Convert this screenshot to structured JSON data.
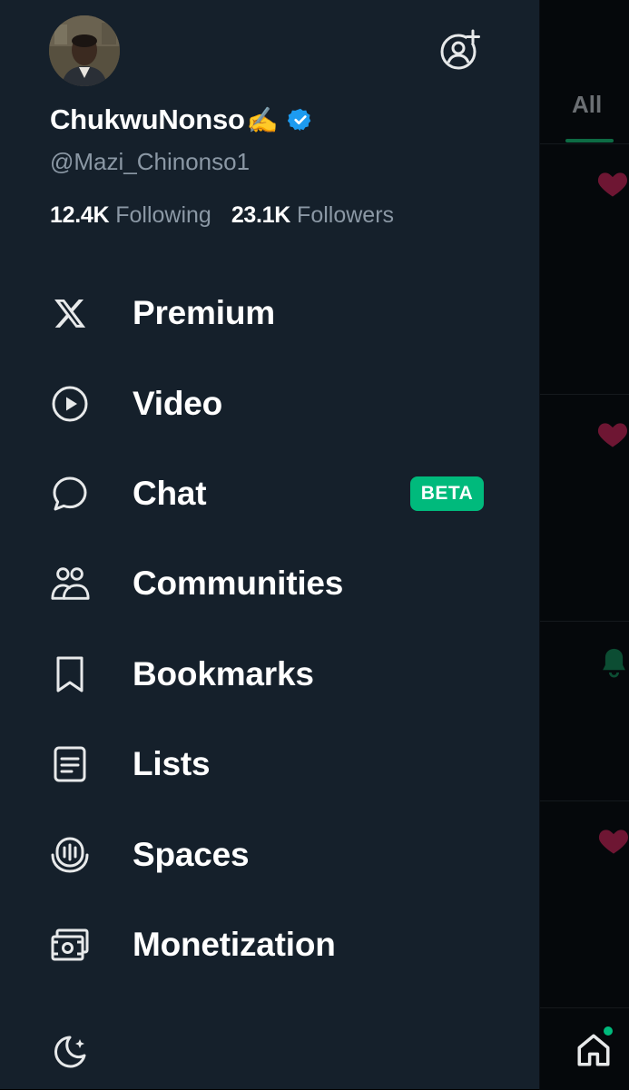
{
  "profile": {
    "display_name": "ChukwuNonso",
    "name_emoji": "✍️",
    "handle": "@Mazi_Chinonso1",
    "following_count": "12.4K",
    "following_label": "Following",
    "followers_count": "23.1K",
    "followers_label": "Followers"
  },
  "menu": {
    "items": [
      {
        "label": "Premium",
        "icon": "x-logo-icon"
      },
      {
        "label": "Video",
        "icon": "play-circle-icon"
      },
      {
        "label": "Chat",
        "icon": "chat-bubble-icon",
        "badge": "BETA"
      },
      {
        "label": "Communities",
        "icon": "communities-icon"
      },
      {
        "label": "Bookmarks",
        "icon": "bookmark-icon"
      },
      {
        "label": "Lists",
        "icon": "list-icon"
      },
      {
        "label": "Spaces",
        "icon": "spaces-icon"
      },
      {
        "label": "Monetization",
        "icon": "money-icon"
      }
    ]
  },
  "background": {
    "tab_label": "All"
  },
  "colors": {
    "drawer_bg": "#15202b",
    "accent_green": "#00ba7c",
    "verified_blue": "#1d9bf0",
    "secondary_text": "#8b98a5"
  }
}
